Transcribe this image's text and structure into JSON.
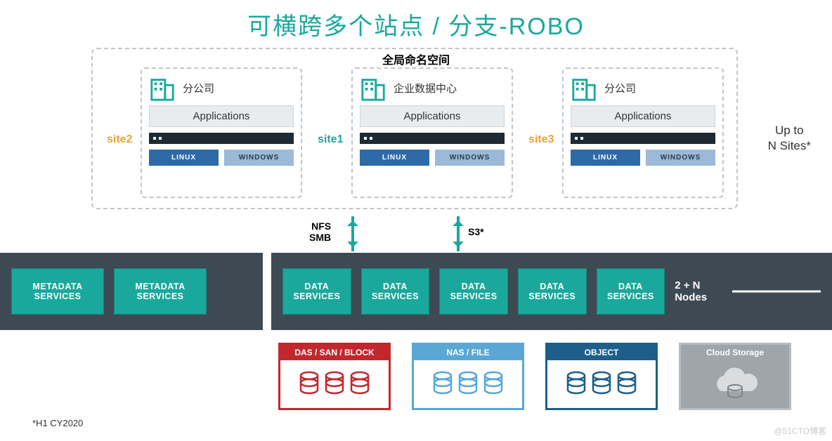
{
  "title": "可横跨多个站点 / 分支-ROBO",
  "gns_label": "全局命名空间",
  "sites": {
    "left": {
      "label": "site2",
      "name": "分公司",
      "app": "Applications",
      "os1": "LINUX",
      "os2": "WINDOWS"
    },
    "center": {
      "label": "site1",
      "name": "企业数据中心",
      "app": "Applications",
      "os1": "LINUX",
      "os2": "WINDOWS"
    },
    "right": {
      "label": "site3",
      "name": "分公司",
      "app": "Applications",
      "os1": "LINUX",
      "os2": "WINDOWS"
    }
  },
  "n_sites": {
    "line1": "Up to",
    "line2": "N Sites*"
  },
  "protocols": {
    "p1a": "NFS",
    "p1b": "SMB",
    "p2": "S3*"
  },
  "services": {
    "metadata": "METADATA SERVICES",
    "data": "DATA SERVICES",
    "metadata_count": 2,
    "data_count": 5,
    "nodes_label": "2 + N Nodes"
  },
  "storage": {
    "das": "DAS / SAN / BLOCK",
    "nas": "NAS / FILE",
    "obj": "OBJECT",
    "cloud": "Cloud Storage"
  },
  "footnote": "*H1 CY2020",
  "watermark": "@51CTO博客",
  "colors": {
    "teal": "#1aa89c",
    "amber": "#e8a33d",
    "slate": "#3d4a54",
    "red": "#c1272d",
    "blue": "#5aa7d4",
    "navy": "#1d5f8a",
    "grey": "#9ea5ab"
  }
}
